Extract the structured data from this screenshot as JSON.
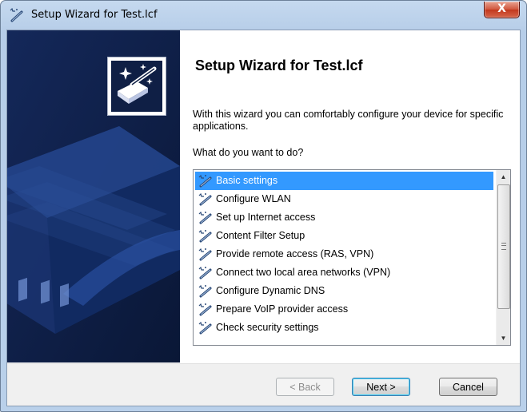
{
  "window": {
    "title": "Setup Wizard for Test.lcf",
    "close_symbol": "X"
  },
  "wizard": {
    "heading": "Setup Wizard for Test.lcf",
    "description": "With this wizard you can comfortably configure your device for specific applications.",
    "question": "What do you want to do?"
  },
  "options": [
    {
      "label": "Basic settings",
      "selected": true
    },
    {
      "label": "Configure WLAN",
      "selected": false
    },
    {
      "label": "Set up Internet access",
      "selected": false
    },
    {
      "label": "Content Filter Setup",
      "selected": false
    },
    {
      "label": "Provide remote access (RAS, VPN)",
      "selected": false
    },
    {
      "label": "Connect two local area networks (VPN)",
      "selected": false
    },
    {
      "label": "Configure Dynamic DNS",
      "selected": false
    },
    {
      "label": "Prepare VoIP provider access",
      "selected": false
    },
    {
      "label": "Check security settings",
      "selected": false
    }
  ],
  "buttons": {
    "back": "< Back",
    "next": "Next >",
    "cancel": "Cancel"
  },
  "colors": {
    "side_panel": "#0e1f47",
    "selection": "#3399ff"
  }
}
